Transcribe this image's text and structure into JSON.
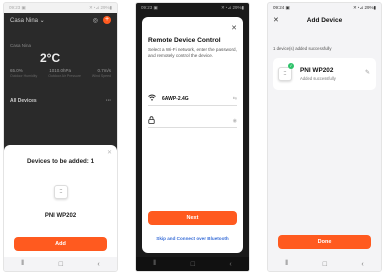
{
  "colors": {
    "accent": "#ff5a1f",
    "link": "#3a6fd8",
    "success": "#2ec26a"
  },
  "phone1": {
    "status": {
      "time": "09:23 ▣",
      "icons": "✕◔⊿ 29%▮"
    },
    "home_name": "Casa Nina ⌄",
    "weather": {
      "city": "Casa Nina",
      "temp": "2°C",
      "stats": [
        "65.0%",
        "1010.0hPa",
        "0.7m/s"
      ],
      "stat_labels": [
        "Outdoor Humidity",
        "Outdoor Air Pressure",
        "Wind Speed"
      ]
    },
    "all_devices": "All Devices",
    "more": "···",
    "sheet": {
      "close": "✕",
      "title": "Devices to be added: 1",
      "device_name": "PNI WP202",
      "button": "Add"
    }
  },
  "phone2": {
    "status": {
      "time": "09:23 ▣",
      "icons": "✕◔⊿ 29%▮"
    },
    "dialog": {
      "close": "✕",
      "title": "Remote Device Control",
      "description": "Select a Wi-Fi network, enter the password, and remotely control the device.",
      "wifi_name": "6AWP-2.4G",
      "wifi_action": "⇆",
      "password_value": "",
      "next_button": "Next",
      "bluetooth_link": "Skip and Connect over Bluetooth"
    }
  },
  "phone3": {
    "status": {
      "time": "09:24 ▣",
      "icons": "✕◔⊿ 29%▮"
    },
    "title": "Add Device",
    "close": "✕",
    "count_text": "1 device(s) added successfully",
    "device": {
      "name": "PNI WP202",
      "sub": "Added successfully"
    },
    "done_button": "Done"
  },
  "navbar": {
    "recent": "⦀",
    "home": "□",
    "back": "‹"
  }
}
